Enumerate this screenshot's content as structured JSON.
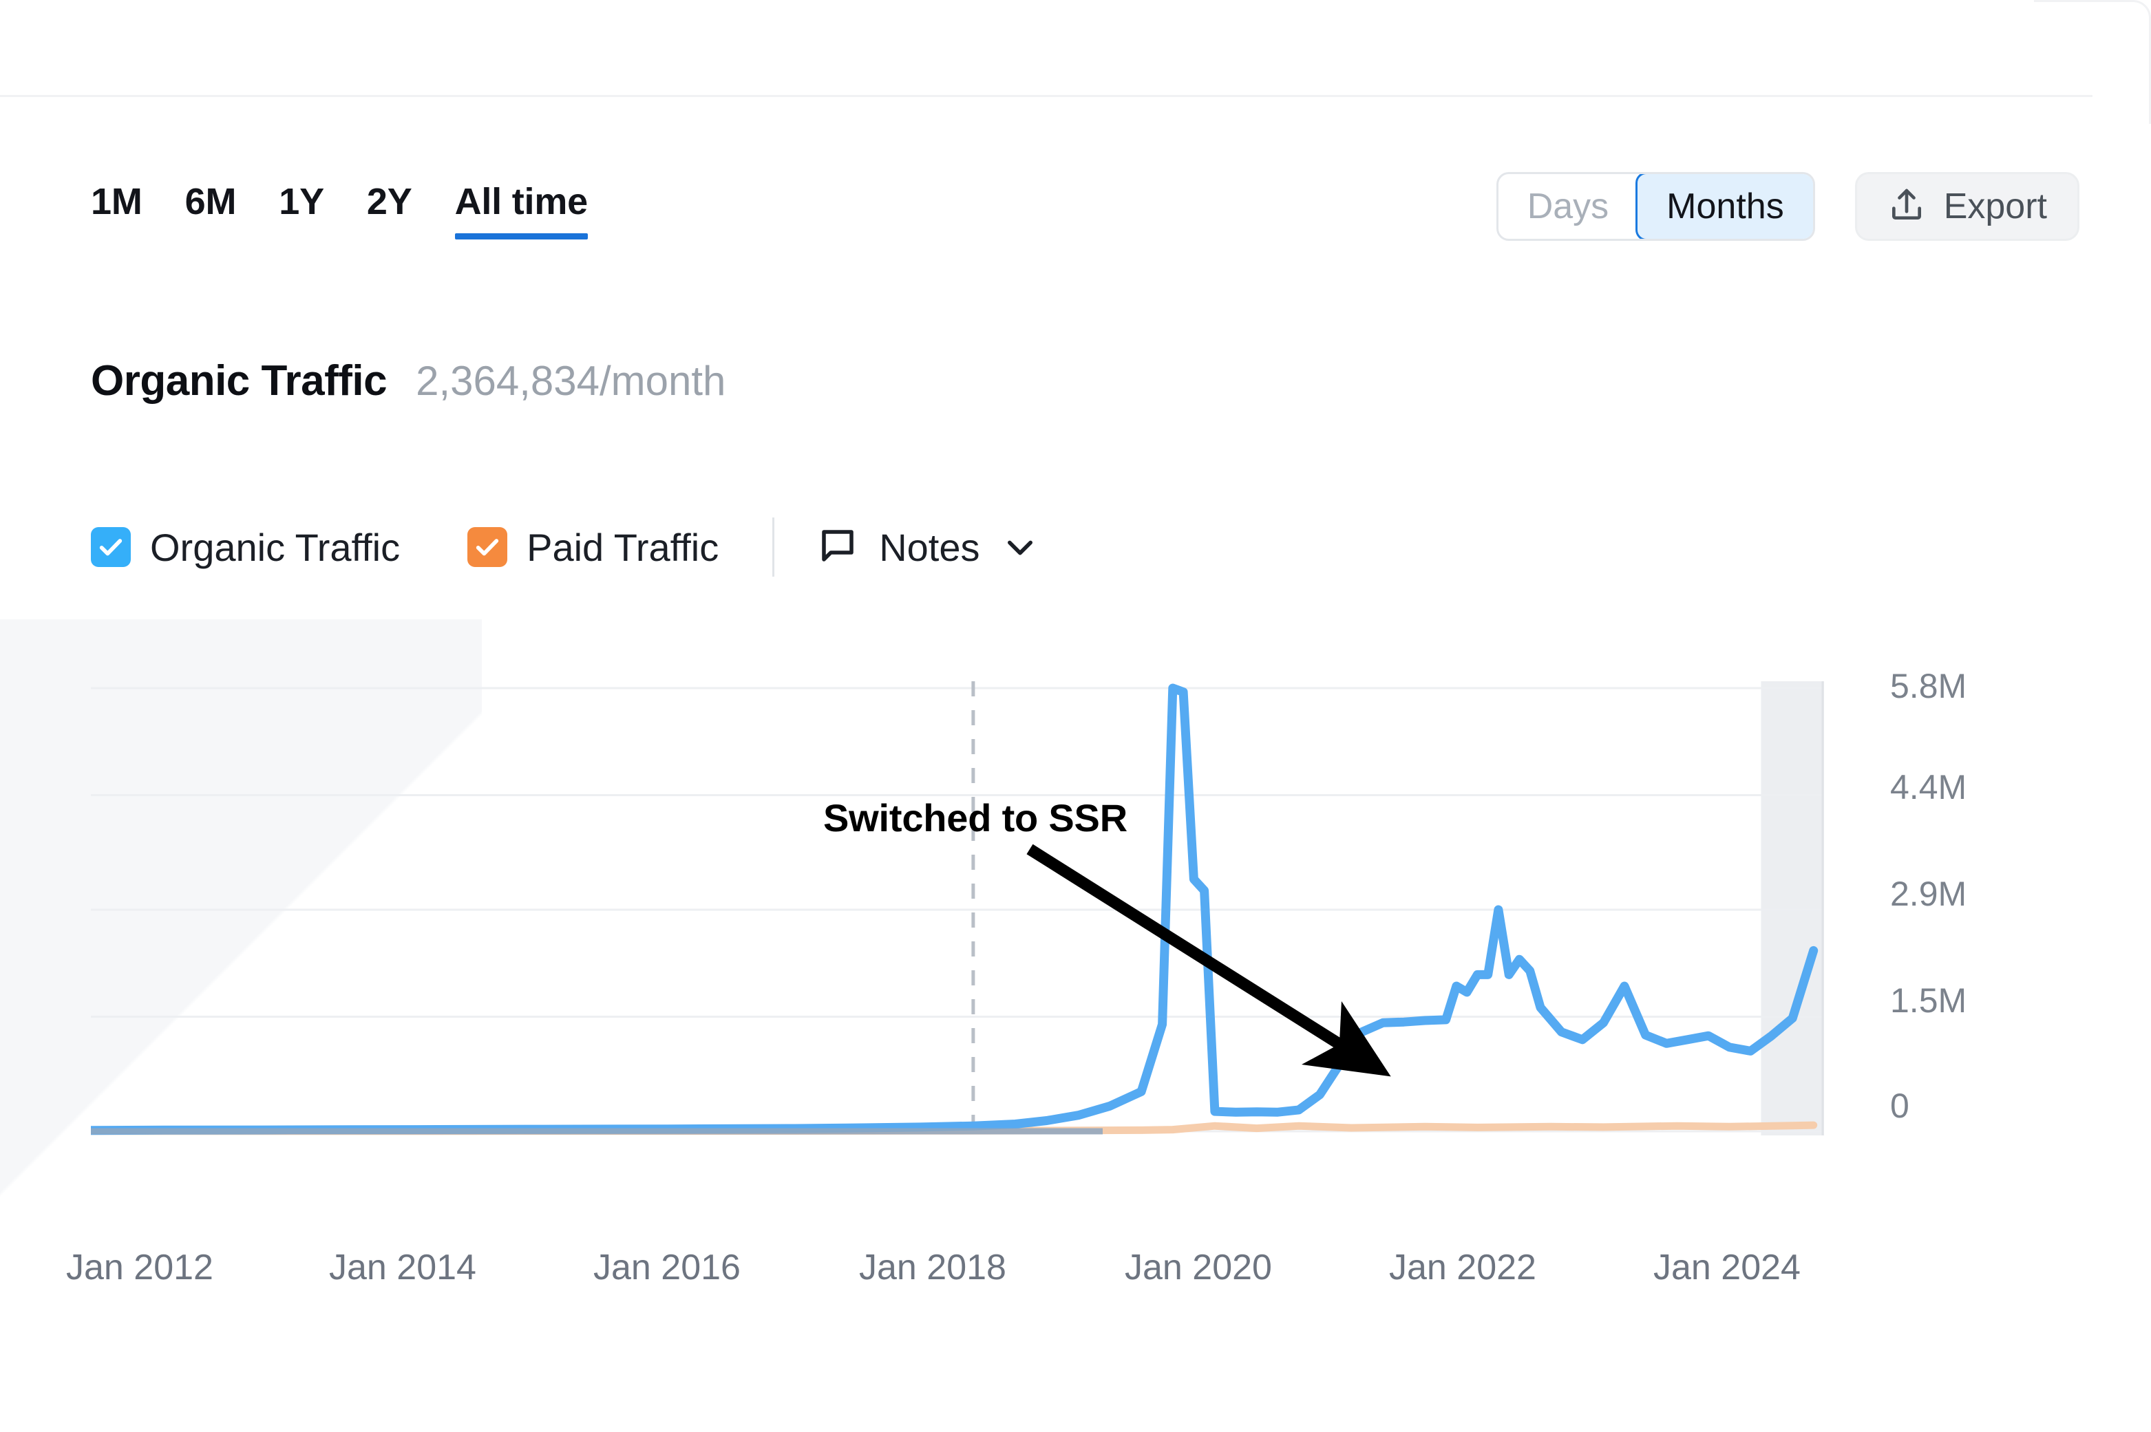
{
  "toolbar": {
    "ranges": [
      {
        "label": "1M",
        "active": false
      },
      {
        "label": "6M",
        "active": false
      },
      {
        "label": "1Y",
        "active": false
      },
      {
        "label": "2Y",
        "active": false
      },
      {
        "label": "All time",
        "active": true
      }
    ],
    "granularity": [
      {
        "label": "Days",
        "selected": false
      },
      {
        "label": "Months",
        "selected": true
      }
    ],
    "export_label": "Export",
    "export_icon": "upload-icon",
    "accent_color": "#1a73d9",
    "selected_fill": "#e1f0fd"
  },
  "header": {
    "title": "Organic Traffic",
    "value": "2,364,834/month"
  },
  "legend": {
    "items": [
      {
        "label": "Organic Traffic",
        "checked": true,
        "color": "#35aff9"
      },
      {
        "label": "Paid Traffic",
        "checked": true,
        "color": "#f58a3e"
      }
    ],
    "notes_label": "Notes",
    "notes_icon": "comment-icon",
    "chevron_icon": "chevron-down-icon"
  },
  "annotation": {
    "text": "Switched to SSR"
  },
  "chart_data": {
    "type": "line",
    "title": "Organic Traffic",
    "xlabel": "",
    "ylabel": "",
    "grid": true,
    "legend_position": "top",
    "ylim": [
      0,
      5800000
    ],
    "yticks": [
      0,
      1500000,
      2900000,
      4400000,
      5800000
    ],
    "ytick_labels": [
      "0",
      "1.5M",
      "2.9M",
      "4.4M",
      "5.8M"
    ],
    "xticks": [
      "Jan 2012",
      "Jan 2014",
      "Jan 2016",
      "Jan 2018",
      "Jan 2020",
      "Jan 2022",
      "Jan 2024"
    ],
    "xlim": [
      "2011-06",
      "2025-03"
    ],
    "marker_line": {
      "x": "2018-06",
      "style": "dashed",
      "color": "#b9bfc7"
    },
    "shaded_region": {
      "from": "2024-09",
      "to": "2025-03",
      "color": "#eceef1"
    },
    "series": [
      {
        "name": "Organic Traffic",
        "color": "#55aaf2",
        "x": [
          "2011-06",
          "2012-01",
          "2013-01",
          "2014-01",
          "2015-01",
          "2016-01",
          "2017-01",
          "2017-06",
          "2018-01",
          "2018-06",
          "2018-10",
          "2019-01",
          "2019-04",
          "2019-07",
          "2019-10",
          "2019-12",
          "2020-01",
          "2020-02",
          "2020-03",
          "2020-04",
          "2020-05",
          "2020-07",
          "2020-09",
          "2020-11",
          "2021-01",
          "2021-03",
          "2021-05",
          "2021-07",
          "2021-09",
          "2021-11",
          "2022-01",
          "2022-03",
          "2022-04",
          "2022-05",
          "2022-06",
          "2022-07",
          "2022-08",
          "2022-09",
          "2022-10",
          "2022-11",
          "2022-12",
          "2023-02",
          "2023-04",
          "2023-06",
          "2023-08",
          "2023-10",
          "2023-12",
          "2024-02",
          "2024-04",
          "2024-06",
          "2024-08",
          "2024-10",
          "2024-12",
          "2025-02"
        ],
        "y": [
          12000,
          15000,
          18000,
          22000,
          26000,
          30000,
          36000,
          42000,
          55000,
          70000,
          95000,
          140000,
          210000,
          330000,
          520000,
          1400000,
          5800000,
          5750000,
          3300000,
          3150000,
          260000,
          250000,
          255000,
          250000,
          280000,
          480000,
          900000,
          1300000,
          1420000,
          1430000,
          1450000,
          1460000,
          1900000,
          1820000,
          2050000,
          2050000,
          2900000,
          2050000,
          2250000,
          2100000,
          1620000,
          1300000,
          1200000,
          1420000,
          1900000,
          1260000,
          1150000,
          1200000,
          1250000,
          1100000,
          1050000,
          1250000,
          1480000,
          2364834
        ]
      },
      {
        "name": "Paid Traffic",
        "color": "#f6cdac",
        "x": [
          "2011-06",
          "2014-01",
          "2016-01",
          "2018-01",
          "2019-01",
          "2019-10",
          "2020-01",
          "2020-05",
          "2020-09",
          "2021-01",
          "2021-06",
          "2022-01",
          "2022-06",
          "2023-01",
          "2023-06",
          "2024-01",
          "2024-06",
          "2024-12",
          "2025-02"
        ],
        "y": [
          2000,
          3000,
          4000,
          6000,
          9000,
          14000,
          22000,
          70000,
          40000,
          70000,
          45000,
          60000,
          50000,
          60000,
          55000,
          70000,
          60000,
          75000,
          80000
        ]
      }
    ]
  }
}
